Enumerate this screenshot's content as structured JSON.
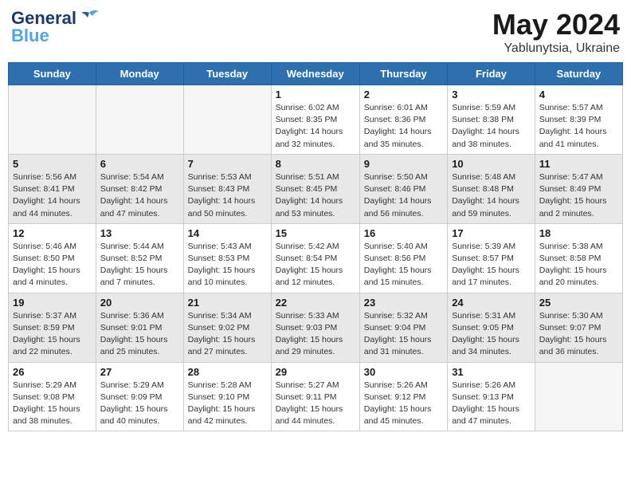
{
  "header": {
    "logo_line1": "General",
    "logo_line2": "Blue",
    "month_year": "May 2024",
    "location": "Yablunytsia, Ukraine"
  },
  "days_of_week": [
    "Sunday",
    "Monday",
    "Tuesday",
    "Wednesday",
    "Thursday",
    "Friday",
    "Saturday"
  ],
  "weeks": [
    {
      "shaded": false,
      "days": [
        {
          "num": "",
          "info": "",
          "empty": true
        },
        {
          "num": "",
          "info": "",
          "empty": true
        },
        {
          "num": "",
          "info": "",
          "empty": true
        },
        {
          "num": "1",
          "info": "Sunrise: 6:02 AM\nSunset: 8:35 PM\nDaylight: 14 hours\nand 32 minutes.",
          "empty": false
        },
        {
          "num": "2",
          "info": "Sunrise: 6:01 AM\nSunset: 8:36 PM\nDaylight: 14 hours\nand 35 minutes.",
          "empty": false
        },
        {
          "num": "3",
          "info": "Sunrise: 5:59 AM\nSunset: 8:38 PM\nDaylight: 14 hours\nand 38 minutes.",
          "empty": false
        },
        {
          "num": "4",
          "info": "Sunrise: 5:57 AM\nSunset: 8:39 PM\nDaylight: 14 hours\nand 41 minutes.",
          "empty": false
        }
      ]
    },
    {
      "shaded": true,
      "days": [
        {
          "num": "5",
          "info": "Sunrise: 5:56 AM\nSunset: 8:41 PM\nDaylight: 14 hours\nand 44 minutes.",
          "empty": false
        },
        {
          "num": "6",
          "info": "Sunrise: 5:54 AM\nSunset: 8:42 PM\nDaylight: 14 hours\nand 47 minutes.",
          "empty": false
        },
        {
          "num": "7",
          "info": "Sunrise: 5:53 AM\nSunset: 8:43 PM\nDaylight: 14 hours\nand 50 minutes.",
          "empty": false
        },
        {
          "num": "8",
          "info": "Sunrise: 5:51 AM\nSunset: 8:45 PM\nDaylight: 14 hours\nand 53 minutes.",
          "empty": false
        },
        {
          "num": "9",
          "info": "Sunrise: 5:50 AM\nSunset: 8:46 PM\nDaylight: 14 hours\nand 56 minutes.",
          "empty": false
        },
        {
          "num": "10",
          "info": "Sunrise: 5:48 AM\nSunset: 8:48 PM\nDaylight: 14 hours\nand 59 minutes.",
          "empty": false
        },
        {
          "num": "11",
          "info": "Sunrise: 5:47 AM\nSunset: 8:49 PM\nDaylight: 15 hours\nand 2 minutes.",
          "empty": false
        }
      ]
    },
    {
      "shaded": false,
      "days": [
        {
          "num": "12",
          "info": "Sunrise: 5:46 AM\nSunset: 8:50 PM\nDaylight: 15 hours\nand 4 minutes.",
          "empty": false
        },
        {
          "num": "13",
          "info": "Sunrise: 5:44 AM\nSunset: 8:52 PM\nDaylight: 15 hours\nand 7 minutes.",
          "empty": false
        },
        {
          "num": "14",
          "info": "Sunrise: 5:43 AM\nSunset: 8:53 PM\nDaylight: 15 hours\nand 10 minutes.",
          "empty": false
        },
        {
          "num": "15",
          "info": "Sunrise: 5:42 AM\nSunset: 8:54 PM\nDaylight: 15 hours\nand 12 minutes.",
          "empty": false
        },
        {
          "num": "16",
          "info": "Sunrise: 5:40 AM\nSunset: 8:56 PM\nDaylight: 15 hours\nand 15 minutes.",
          "empty": false
        },
        {
          "num": "17",
          "info": "Sunrise: 5:39 AM\nSunset: 8:57 PM\nDaylight: 15 hours\nand 17 minutes.",
          "empty": false
        },
        {
          "num": "18",
          "info": "Sunrise: 5:38 AM\nSunset: 8:58 PM\nDaylight: 15 hours\nand 20 minutes.",
          "empty": false
        }
      ]
    },
    {
      "shaded": true,
      "days": [
        {
          "num": "19",
          "info": "Sunrise: 5:37 AM\nSunset: 8:59 PM\nDaylight: 15 hours\nand 22 minutes.",
          "empty": false
        },
        {
          "num": "20",
          "info": "Sunrise: 5:36 AM\nSunset: 9:01 PM\nDaylight: 15 hours\nand 25 minutes.",
          "empty": false
        },
        {
          "num": "21",
          "info": "Sunrise: 5:34 AM\nSunset: 9:02 PM\nDaylight: 15 hours\nand 27 minutes.",
          "empty": false
        },
        {
          "num": "22",
          "info": "Sunrise: 5:33 AM\nSunset: 9:03 PM\nDaylight: 15 hours\nand 29 minutes.",
          "empty": false
        },
        {
          "num": "23",
          "info": "Sunrise: 5:32 AM\nSunset: 9:04 PM\nDaylight: 15 hours\nand 31 minutes.",
          "empty": false
        },
        {
          "num": "24",
          "info": "Sunrise: 5:31 AM\nSunset: 9:05 PM\nDaylight: 15 hours\nand 34 minutes.",
          "empty": false
        },
        {
          "num": "25",
          "info": "Sunrise: 5:30 AM\nSunset: 9:07 PM\nDaylight: 15 hours\nand 36 minutes.",
          "empty": false
        }
      ]
    },
    {
      "shaded": false,
      "days": [
        {
          "num": "26",
          "info": "Sunrise: 5:29 AM\nSunset: 9:08 PM\nDaylight: 15 hours\nand 38 minutes.",
          "empty": false
        },
        {
          "num": "27",
          "info": "Sunrise: 5:29 AM\nSunset: 9:09 PM\nDaylight: 15 hours\nand 40 minutes.",
          "empty": false
        },
        {
          "num": "28",
          "info": "Sunrise: 5:28 AM\nSunset: 9:10 PM\nDaylight: 15 hours\nand 42 minutes.",
          "empty": false
        },
        {
          "num": "29",
          "info": "Sunrise: 5:27 AM\nSunset: 9:11 PM\nDaylight: 15 hours\nand 44 minutes.",
          "empty": false
        },
        {
          "num": "30",
          "info": "Sunrise: 5:26 AM\nSunset: 9:12 PM\nDaylight: 15 hours\nand 45 minutes.",
          "empty": false
        },
        {
          "num": "31",
          "info": "Sunrise: 5:26 AM\nSunset: 9:13 PM\nDaylight: 15 hours\nand 47 minutes.",
          "empty": false
        },
        {
          "num": "",
          "info": "",
          "empty": true
        }
      ]
    }
  ]
}
